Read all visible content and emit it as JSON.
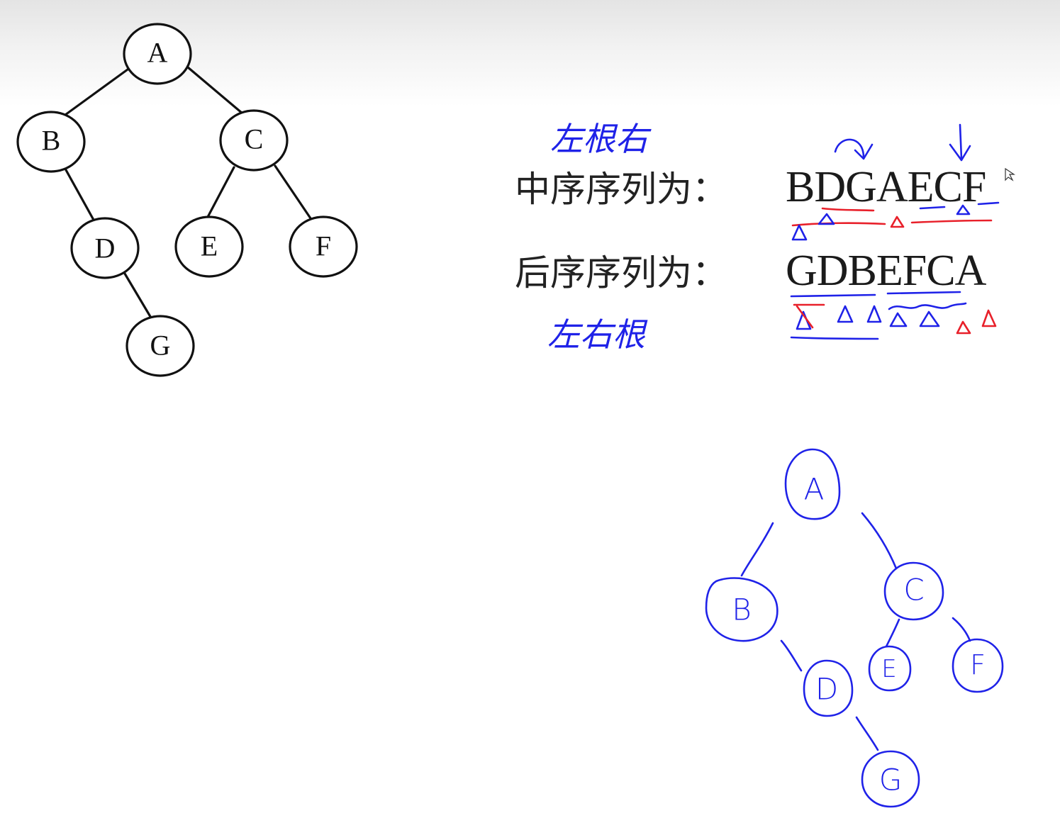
{
  "printed_tree": {
    "nodes": [
      {
        "id": "A",
        "label": "A"
      },
      {
        "id": "B",
        "label": "B"
      },
      {
        "id": "C",
        "label": "C"
      },
      {
        "id": "D",
        "label": "D"
      },
      {
        "id": "E",
        "label": "E"
      },
      {
        "id": "F",
        "label": "F"
      },
      {
        "id": "G",
        "label": "G"
      }
    ],
    "edges": [
      [
        "A",
        "B"
      ],
      [
        "A",
        "C"
      ],
      [
        "B",
        "D"
      ],
      [
        "C",
        "E"
      ],
      [
        "C",
        "F"
      ],
      [
        "D",
        "G"
      ]
    ]
  },
  "sequences": {
    "inorder_label": "中序序列为：",
    "inorder_value": "BDGAECF",
    "postorder_label": "后序序列为：",
    "postorder_value": "GDBEFCA"
  },
  "annotations": {
    "inorder_note": "左根右",
    "postorder_note": "左右根"
  },
  "handdrawn_tree": {
    "nodes": [
      {
        "id": "A",
        "label": "A"
      },
      {
        "id": "B",
        "label": "B"
      },
      {
        "id": "C",
        "label": "C"
      },
      {
        "id": "D",
        "label": "D"
      },
      {
        "id": "E",
        "label": "E"
      },
      {
        "id": "F",
        "label": "F"
      },
      {
        "id": "G",
        "label": "G"
      }
    ]
  },
  "colors": {
    "ink": "#111111",
    "pen_blue": "#1f22e8",
    "pen_red": "#e8202a"
  }
}
